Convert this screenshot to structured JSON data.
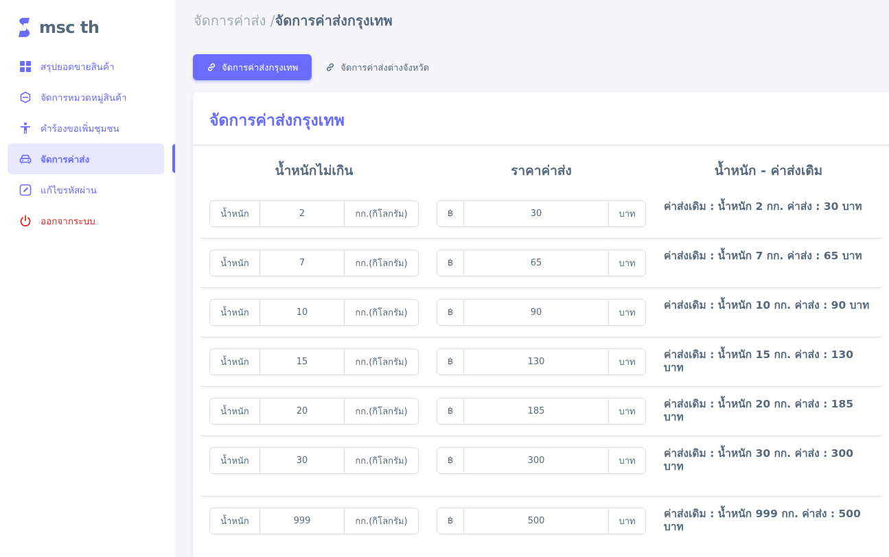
{
  "app": {
    "name": "msc th"
  },
  "sidebar": {
    "items": [
      {
        "label": "สรุปยอดขายสินค้า",
        "icon": "dashboard-grid-icon"
      },
      {
        "label": "จัดการหมวดหมู่สินค้า",
        "icon": "category-hexagon-icon"
      },
      {
        "label": "คำร้องขอเพิ่มชุมชน",
        "icon": "person-icon"
      },
      {
        "label": "จัดการค่าส่ง",
        "icon": "car-icon"
      },
      {
        "label": "แก้ไขรหัสผ่าน",
        "icon": "edit-square-icon"
      },
      {
        "label": "ออกจากระบบ",
        "icon": "power-icon"
      }
    ]
  },
  "breadcrumb": {
    "parent": "จัดการค่าส่ง /",
    "current": "จัดการค่าส่งกรุงเทพ"
  },
  "tabs": [
    {
      "label": "จัดการค่าส่งกรุงเทพ",
      "icon": "link-icon"
    },
    {
      "label": "จัดการค่าส่งต่างจังหวัด",
      "icon": "link-icon"
    }
  ],
  "card": {
    "title": "จัดการค่าส่งกรุงเทพ",
    "headers": {
      "weight": "น้ำหนักไม่เกิน",
      "price": "ราคาค่าส่ง",
      "previous": "น้ำหนัก - ค่าส่งเดิม"
    },
    "weight_prefix": "น้ำหนัก",
    "weight_unit": "กก.(กิโลกรัม)",
    "currency_symbol": "฿",
    "price_unit": "บาท",
    "rows": [
      {
        "weight": "2",
        "price": "30",
        "info": "ค่าส่งเดิม : น้ำหนัก 2 กก. ค่าส่ง : 30 บาท"
      },
      {
        "weight": "7",
        "price": "65",
        "info": "ค่าส่งเดิม : น้ำหนัก 7 กก. ค่าส่ง : 65 บาท"
      },
      {
        "weight": "10",
        "price": "90",
        "info": "ค่าส่งเดิม : น้ำหนัก 10 กก. ค่าส่ง : 90 บาท"
      },
      {
        "weight": "15",
        "price": "130",
        "info": "ค่าส่งเดิม : น้ำหนัก 15 กก. ค่าส่ง : 130 บาท"
      },
      {
        "weight": "20",
        "price": "185",
        "info": "ค่าส่งเดิม : น้ำหนัก 20 กก. ค่าส่ง : 185 บาท"
      },
      {
        "weight": "30",
        "price": "300",
        "info": "ค่าส่งเดิม : น้ำหนัก 30 กก. ค่าส่ง : 300 บาท"
      },
      {
        "weight": "999",
        "price": "500",
        "info": "ค่าส่งเดิม : น้ำหนัก 999 กก. ค่าส่ง : 500 บาท"
      }
    ]
  },
  "colors": {
    "primary": "#696cff",
    "text": "#566a7f",
    "danger": "#e8261c",
    "background": "#f5f5f9"
  }
}
